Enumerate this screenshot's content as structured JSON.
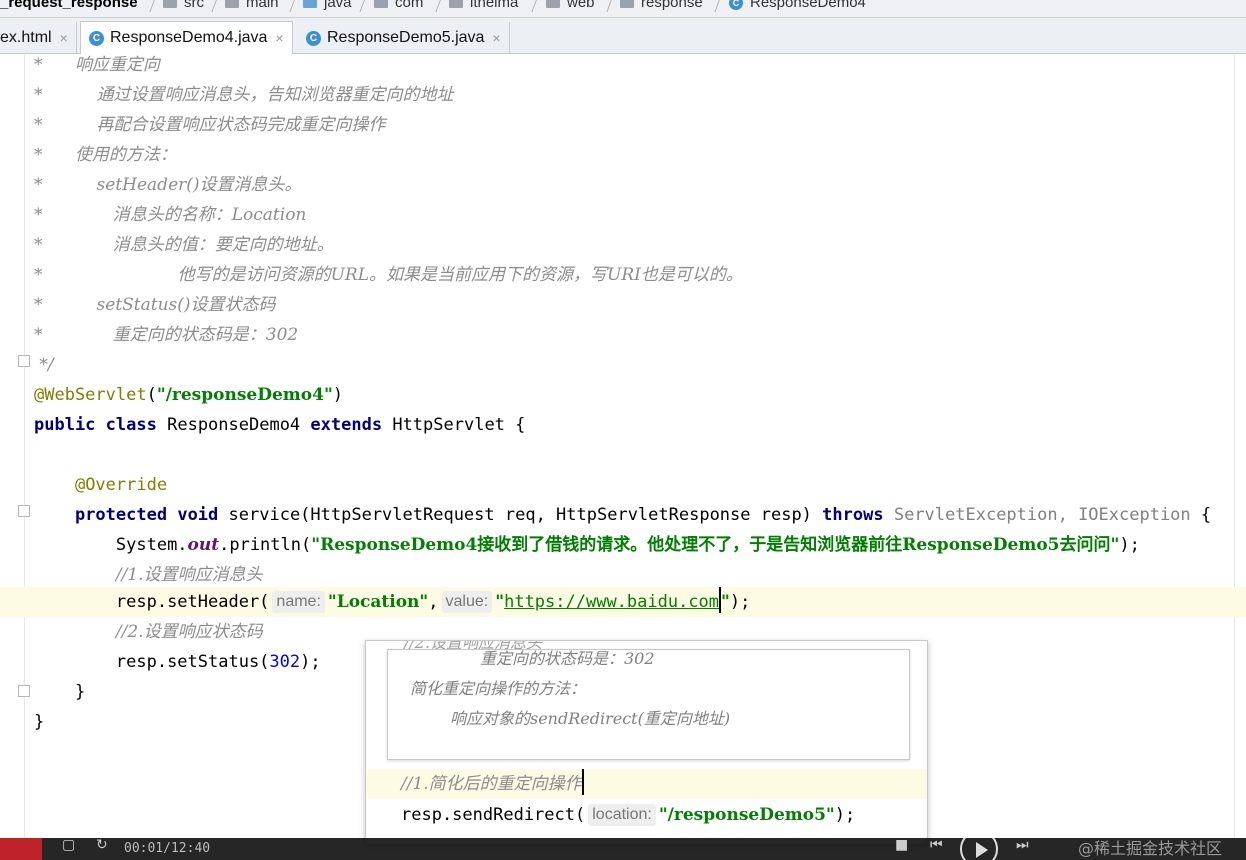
{
  "breadcrumb": {
    "project": "_request_response",
    "items": [
      "src",
      "main",
      "java",
      "com",
      "itheima",
      "web",
      "response",
      "ResponseDemo4"
    ]
  },
  "tabs": [
    {
      "label": "ex.html",
      "active": false
    },
    {
      "label": "ResponseDemo4.java",
      "active": true
    },
    {
      "label": "ResponseDemo5.java",
      "active": false
    }
  ],
  "code": {
    "c0_star": "*",
    "c0": "响应重定向",
    "c1_star": "*",
    "c1": "通过设置响应消息头，告知浏览器重定向的地址",
    "c2_star": "*",
    "c2": "再配合设置响应状态码完成重定向操作",
    "c3_star": "*",
    "c3": "使用的方法：",
    "c4_star": "*",
    "c4": "setHeader()设置消息头。",
    "c5_star": "*",
    "c5": "消息头的名称：Location",
    "c6_star": "*",
    "c6": "消息头的值：要定向的地址。",
    "c7_star": "*",
    "c7": "他写的是访问资源的URL。如果是当前应用下的资源，写URI也是可以的。",
    "c8_star": "*",
    "c8": "setStatus()设置状态码",
    "c9_star": "*",
    "c9": "重定向的状态码是：302",
    "c10": "*/",
    "ann_servlet": "@WebServlet",
    "servlet_path": "\"/responseDemo4\"",
    "kw_public": "public",
    "kw_class": "class",
    "class_name": "ResponseDemo4",
    "kw_extends": "extends",
    "super_name": "HttpServlet {",
    "ann_override": "@Override",
    "kw_protected": "protected",
    "kw_void": "void",
    "method_sig": "service(HttpServletRequest req, HttpServletResponse resp)",
    "kw_throws": "throws",
    "exceptions": "ServletException, IOException",
    "brace_open": " {",
    "sys_prefix": "System.",
    "sys_out": "out",
    "sys_println": ".println(",
    "println_str": "\"ResponseDemo4接收到了借钱的请求。他处理不了，于是告知浏览器前往ResponseDemo5去问问\"",
    "println_end": ");",
    "comment1": "//1.设置响应消息头",
    "setheader_call": "resp.setHeader(",
    "hint_name": "name:",
    "location_str": "\"Location\"",
    "comma": ",",
    "hint_value": "value:",
    "url_quote_open": "\"",
    "url": "https://www.baidu.com",
    "url_quote_close": "\"",
    "setheader_end": ");",
    "comment2": "//2.设置响应状态码",
    "setstatus_call": "resp.setStatus(",
    "status_num": "302",
    "setstatus_end": ");",
    "close_inner": "}",
    "close_outer": "}"
  },
  "popup": {
    "ghost_line": "//2.设置响应消息头",
    "doc_line1": "重定向的状态码是：302",
    "doc_line2": "简化重定向操作的方法：",
    "doc_line3": "响应对象的sendRedirect(重定向地址)",
    "comment": "//1.简化后的重定向操作",
    "redirect_call": "resp.sendRedirect(",
    "hint_location": "location:",
    "redirect_path": "\"/responseDemo5\"",
    "redirect_end": ");"
  },
  "player": {
    "time": "00:01/12:40",
    "watermark": "@稀土掘金技术社区"
  },
  "colors": {
    "keyword": "#000080",
    "string": "#008000",
    "comment": "#8c8c8c",
    "annotation": "#808000",
    "number": "#0000ff",
    "current_line": "#fdfbe4"
  }
}
